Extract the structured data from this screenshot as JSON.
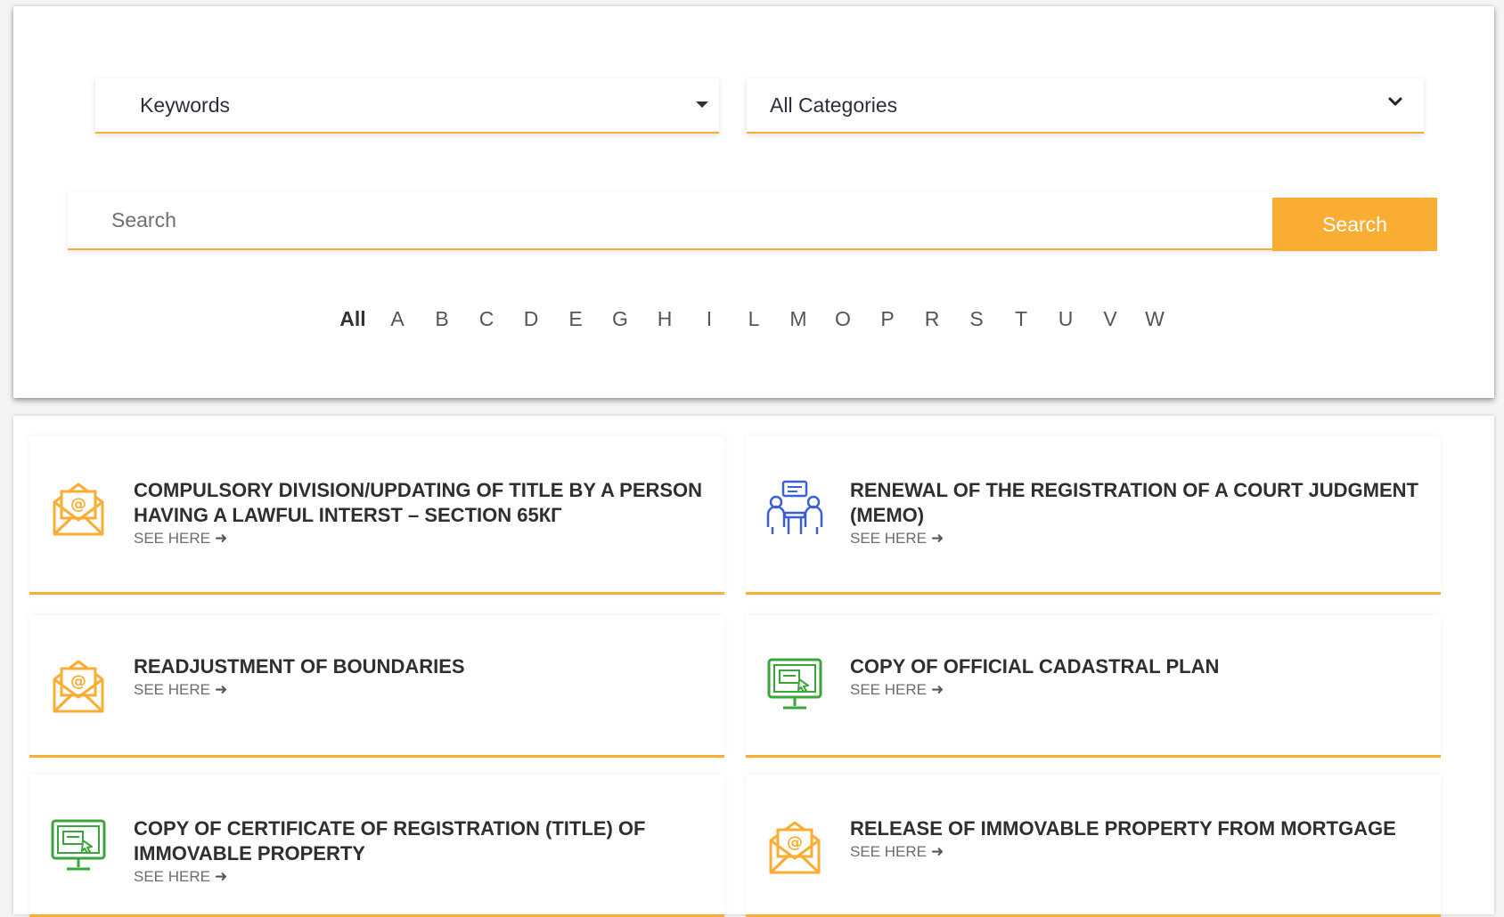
{
  "filters": {
    "keywords_label": "Keywords",
    "categories_label": "All Categories"
  },
  "search": {
    "placeholder": "Search",
    "button_label": "Search"
  },
  "alphabet": [
    "All",
    "A",
    "B",
    "C",
    "D",
    "E",
    "G",
    "H",
    "I",
    "L",
    "M",
    "O",
    "P",
    "R",
    "S",
    "T",
    "U",
    "V",
    "W"
  ],
  "active_letter": "All",
  "see_here_label": "SEE HERE",
  "colors": {
    "accent": "#f9ad32",
    "icon_orange": "#f9ad32",
    "icon_green": "#3aa63a",
    "icon_blue": "#3b5fd6"
  },
  "results": [
    {
      "title": "COMPULSORY DIVISION/UPDATING OF TITLE BY A PERSON HAVING A LAWFUL INTERST – SECTION 65КГ",
      "icon": "email-icon"
    },
    {
      "title": "RENEWAL OF THE REGISTRATION OF A COURT JUDGMENT (MEMO)",
      "icon": "meeting-icon"
    },
    {
      "title": "READJUSTMENT OF BOUNDARIES",
      "icon": "email-icon"
    },
    {
      "title": "COPY OF OFFICIAL CADASTRAL PLAN",
      "icon": "computer-icon"
    },
    {
      "title": "COPY OF CERTIFICATE OF REGISTRATION (TITLE) OF IMMOVABLE PROPERTY",
      "icon": "computer-icon"
    },
    {
      "title": "RELEASE OF IMMOVABLE PROPERTY FROM MORTGAGE",
      "icon": "email-icon"
    }
  ]
}
